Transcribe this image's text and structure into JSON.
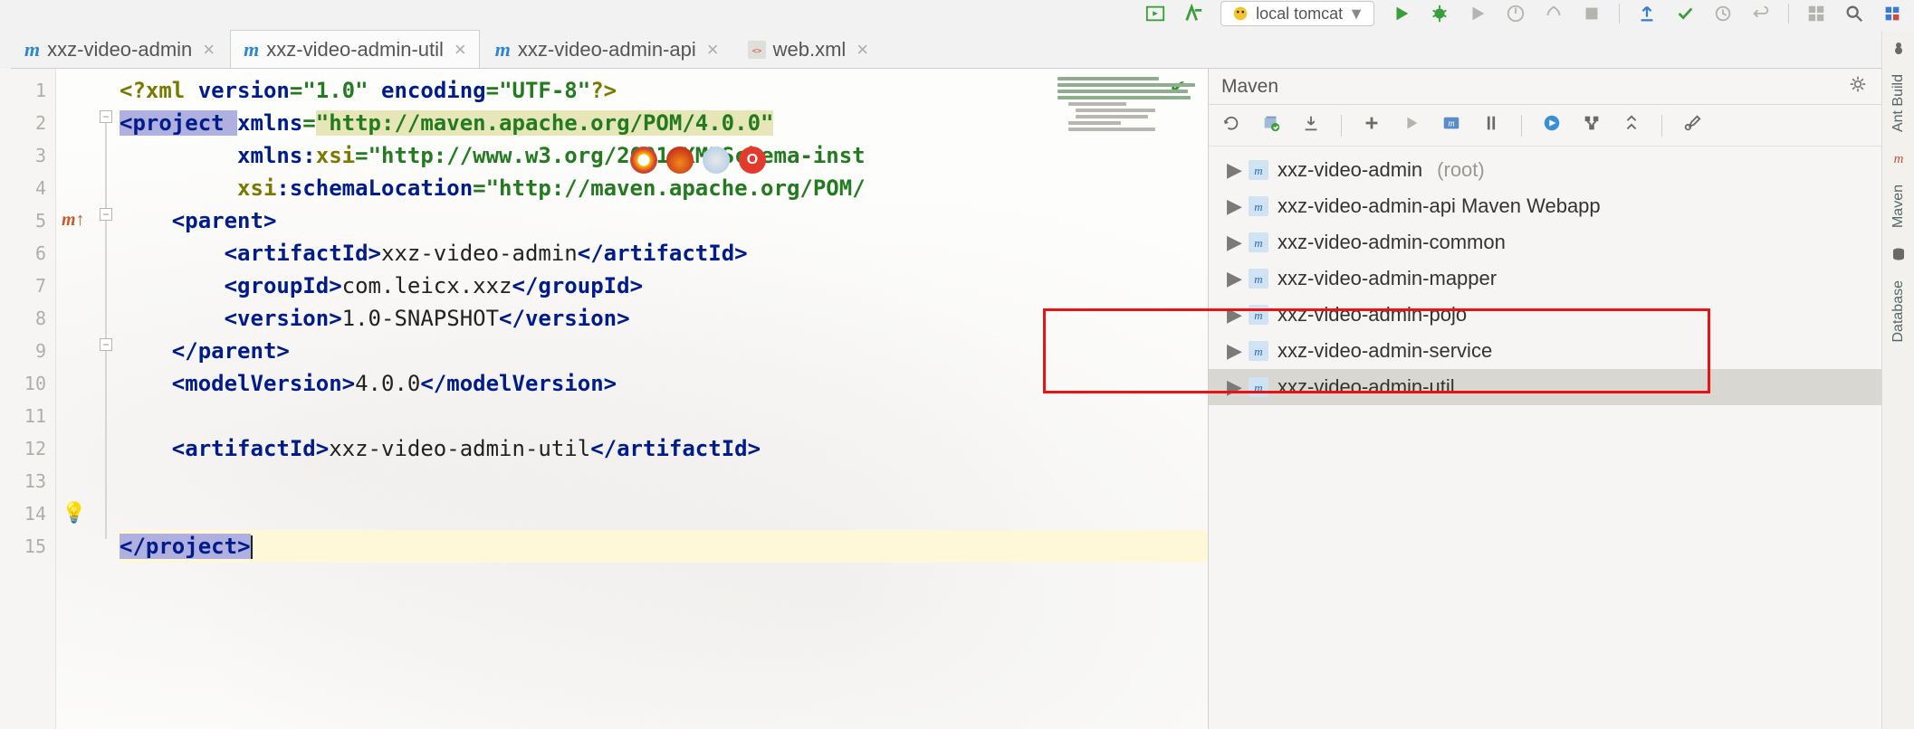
{
  "runConfig": {
    "label": "local tomcat"
  },
  "tabs": [
    {
      "label": "xxz-video-admin",
      "icon": "m",
      "close": "×"
    },
    {
      "label": "xxz-video-admin-util",
      "icon": "m",
      "close": "×",
      "active": true
    },
    {
      "label": "xxz-video-admin-api",
      "icon": "m",
      "close": "×"
    },
    {
      "label": "web.xml",
      "icon": "xml",
      "close": "×"
    }
  ],
  "editor": {
    "lines": [
      "1",
      "2",
      "3",
      "4",
      "5",
      "6",
      "7",
      "8",
      "9",
      "10",
      "11",
      "12",
      "13",
      "14",
      "15"
    ],
    "code": {
      "l1_pi_open": "<?",
      "l1_xml": "xml ",
      "l1_ver_attr": "version",
      "l1_eq": "=",
      "l1_ver_val": "\"1.0\"",
      "l1_sp": " ",
      "l1_enc_attr": "encoding",
      "l1_enc_val": "\"UTF-8\"",
      "l1_pi_close": "?>",
      "l2_open": "<",
      "l2_tag": "project ",
      "l2_xmlns": "xmlns",
      "l2_eq": "=",
      "l2_xmlns_val": "\"http://maven.apache.org/POM/4.0.0\"",
      "l3_indent": "         ",
      "l3_xmlns": "xmlns:",
      "l3_xsi": "xsi",
      "l3_eq": "=",
      "l3_val": "\"http://www.w3.org/2001/XMLSchema-inst",
      "l4_indent": "         ",
      "l4_xsi": "xsi",
      "l4_colon": ":",
      "l4_schema": "schemaLocation",
      "l4_eq": "=",
      "l4_val": "\"http://maven.apache.org/POM/",
      "l5_open": "    <",
      "l5_tag": "parent",
      "l5_close": ">",
      "l6_open": "        <",
      "l6_tag": "artifactId",
      "l6_close": ">",
      "l6_txt": "xxz-video-admin",
      "l6_end_open": "</",
      "l6_end_close": ">",
      "l7_open": "        <",
      "l7_tag": "groupId",
      "l7_close": ">",
      "l7_txt": "com.leicx.xxz",
      "l7_end_open": "</",
      "l7_end_close": ">",
      "l8_open": "        <",
      "l8_tag": "version",
      "l8_close": ">",
      "l8_txt": "1.0-SNAPSHOT",
      "l8_end_open": "</",
      "l8_end_close": ">",
      "l9_open": "    </",
      "l9_tag": "parent",
      "l9_close": ">",
      "l10_open": "    <",
      "l10_tag": "modelVersion",
      "l10_close": ">",
      "l10_txt": "4.0.0",
      "l10_end_open": "</",
      "l10_end_close": ">",
      "l12_open": "    <",
      "l12_tag": "artifactId",
      "l12_close": ">",
      "l12_txt": "xxz-video-admin-util",
      "l12_end_open": "</",
      "l12_end_close": ">",
      "l15_open": "</",
      "l15_tag": "project",
      "l15_close": ">"
    }
  },
  "maven": {
    "title": "Maven",
    "items": [
      {
        "label": "xxz-video-admin",
        "note": "(root)"
      },
      {
        "label": "xxz-video-admin-api Maven Webapp"
      },
      {
        "label": "xxz-video-admin-common"
      },
      {
        "label": "xxz-video-admin-mapper"
      },
      {
        "label": "xxz-video-admin-pojo"
      },
      {
        "label": "xxz-video-admin-service"
      },
      {
        "label": "xxz-video-admin-util",
        "selected": true
      }
    ]
  },
  "rightStrip": {
    "ant": "Ant Build",
    "maven": "Maven",
    "db": "Database"
  }
}
